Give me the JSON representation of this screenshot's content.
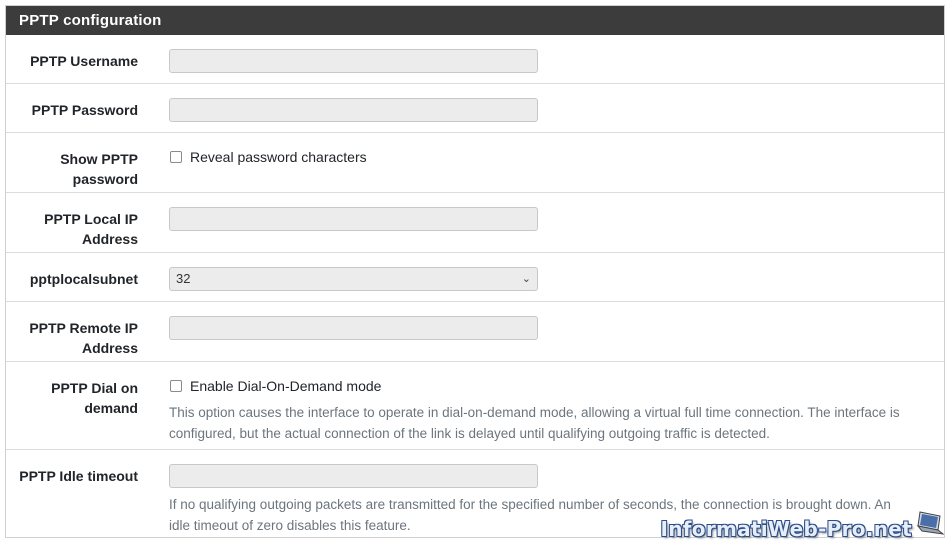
{
  "panel": {
    "title": "PPTP configuration"
  },
  "fields": {
    "username": {
      "label": "PPTP Username",
      "value": ""
    },
    "password": {
      "label": "PPTP Password",
      "value": ""
    },
    "show_password": {
      "label_line1": "Show PPTP",
      "label_line2": "password",
      "checkbox_label": "Reveal password characters",
      "checked": false
    },
    "local_ip": {
      "label_line1": "PPTP Local IP",
      "label_line2": "Address",
      "value": ""
    },
    "local_subnet": {
      "label": "pptplocalsubnet",
      "selected": "32"
    },
    "remote_ip": {
      "label_line1": "PPTP Remote IP",
      "label_line2": "Address",
      "value": ""
    },
    "dial_on_demand": {
      "label_line1": "PPTP Dial on",
      "label_line2": "demand",
      "checkbox_label": "Enable Dial-On-Demand mode",
      "checked": false,
      "help_line1": "This option causes the interface to operate in dial-on-demand mode, allowing a virtual full time connection. The interface is",
      "help_line2": "configured, but the actual connection of the link is delayed until qualifying outgoing traffic is detected."
    },
    "idle_timeout": {
      "label": "PPTP Idle timeout",
      "value": "",
      "help_line1": "If no qualifying outgoing packets are transmitted for the specified number of seconds, the connection is brought down. An",
      "help_line2": "idle timeout of zero disables this feature."
    }
  },
  "watermark": {
    "text": "InformatiWeb-Pro.net",
    "icon": "laptop-icon"
  },
  "colors": {
    "heading_bg": "#3c3c3c",
    "input_bg": "#ececec",
    "help_text": "#6c757d"
  }
}
